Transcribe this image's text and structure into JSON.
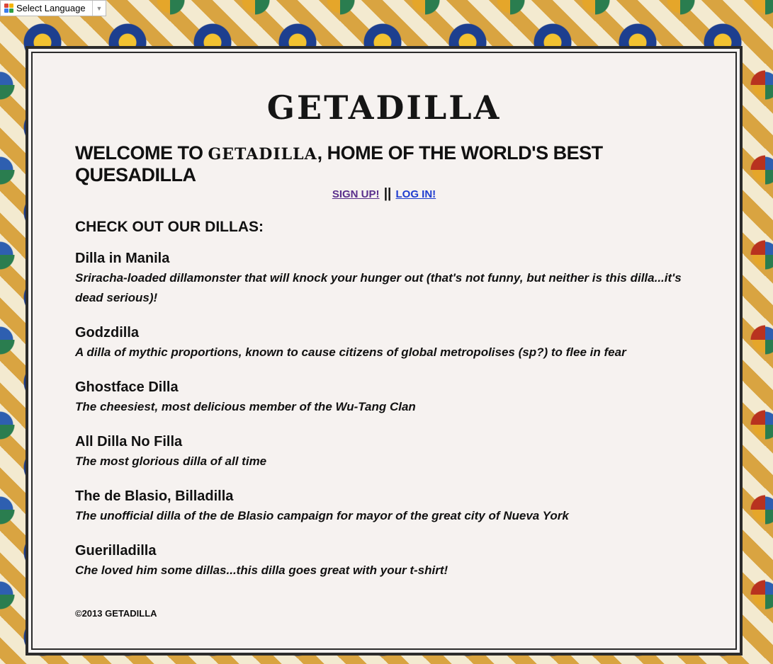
{
  "translate": {
    "label": "Select Language",
    "icon": "google-translate-icon",
    "arrow": "▼"
  },
  "header": {
    "logo": "GETADILLA",
    "welcome_prefix": "WELCOME TO ",
    "welcome_brand": "GETADILLA",
    "welcome_suffix": ", HOME OF THE WORLD'S BEST QUESADILLA"
  },
  "auth": {
    "signup_label": "SIGN UP!",
    "separator": "||",
    "login_label": "LOG IN!"
  },
  "menu": {
    "title": "CHECK OUT OUR DILLAS:",
    "items": [
      {
        "name": "Dilla in Manila",
        "description": "Sriracha-loaded dillamonster that will knock your hunger out (that's not funny, but neither is this dilla...it's dead serious)!"
      },
      {
        "name": "Godzdilla",
        "description": "A dilla of mythic proportions, known to cause citizens of global metropolises (sp?) to flee in fear"
      },
      {
        "name": "Ghostface Dilla",
        "description": "The cheesiest, most delicious member of the Wu-Tang Clan"
      },
      {
        "name": "All Dilla No Filla",
        "description": "The most glorious dilla of all time"
      },
      {
        "name": "The de Blasio, Billadilla",
        "description": "The unofficial dilla of the de Blasio campaign for mayor of the great city of Nueva York"
      },
      {
        "name": "Guerilladilla",
        "description": "Che loved him some dillas...this dilla goes great with your t-shirt!"
      }
    ]
  },
  "footer": {
    "copyright": "©2013 GETADILLA"
  },
  "colors": {
    "panel_border": "#2b2b2b",
    "signup_link": "#5a2f8c",
    "login_link": "#1e3ccf"
  }
}
